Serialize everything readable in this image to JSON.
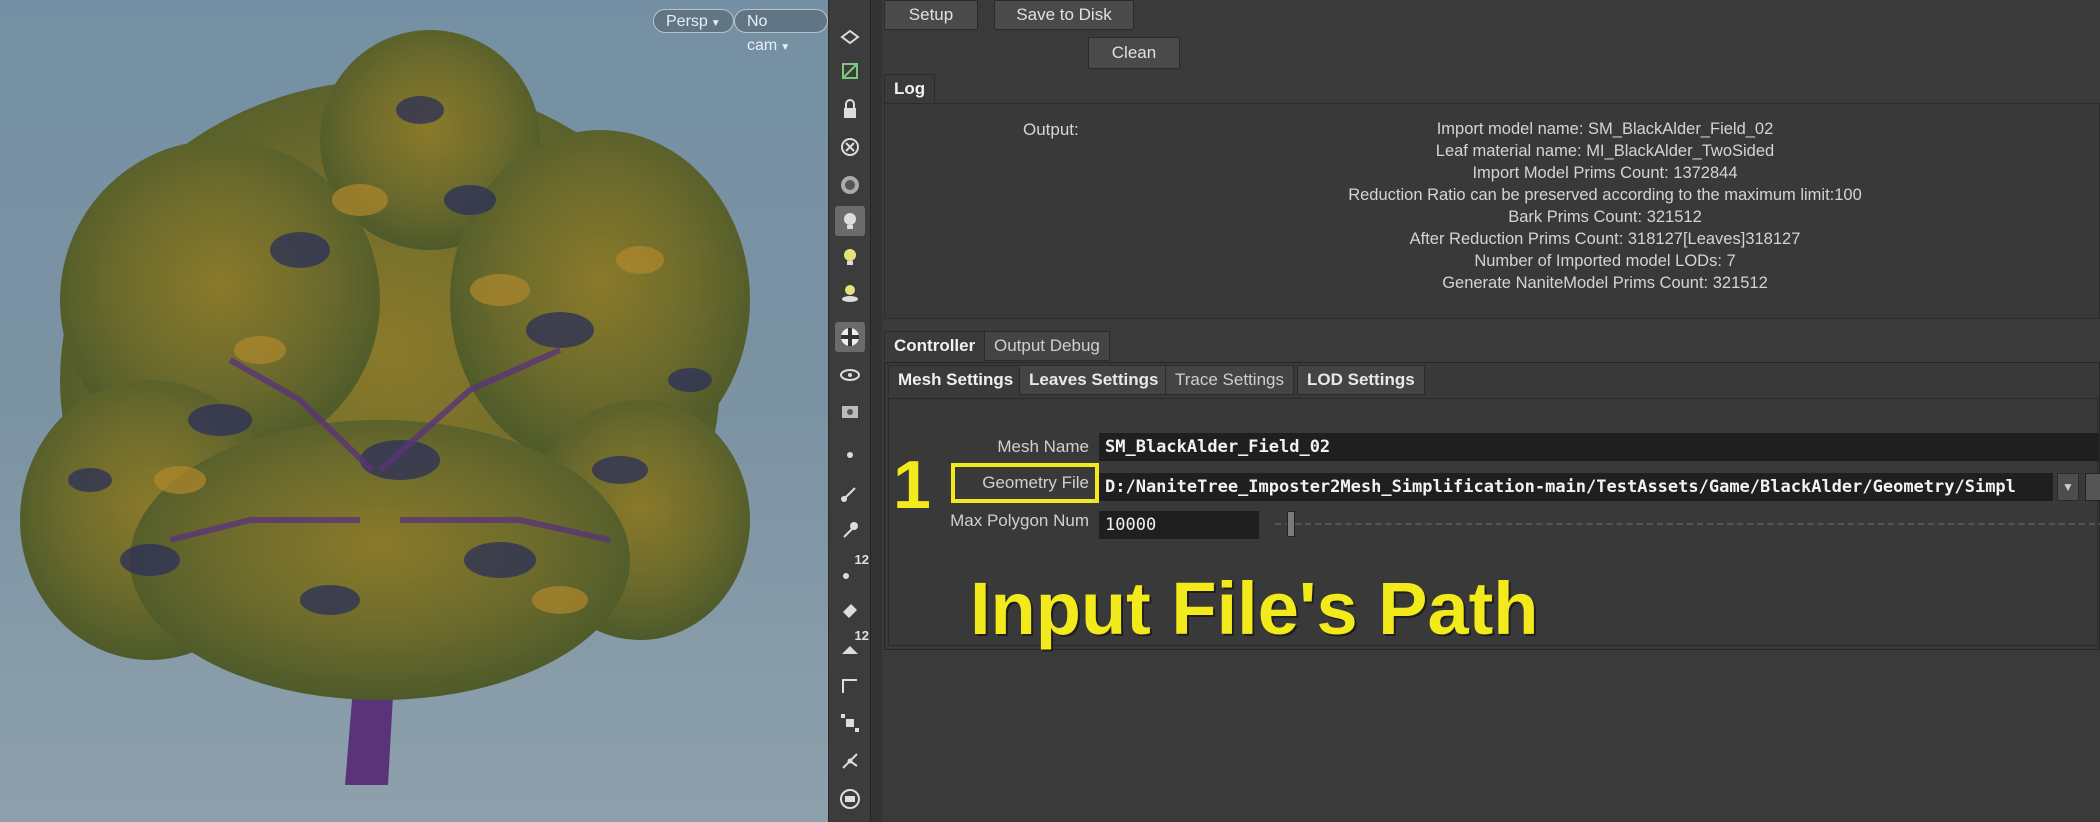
{
  "viewport": {
    "persp_label": "Persp",
    "cam_label": "No cam"
  },
  "toolbar": {
    "icons": [
      "select-object-icon",
      "display-geometry-icon",
      "lock-icon",
      "light-off-icon",
      "ambient-occlusion-icon",
      "light-bulb-icon",
      "light-add-icon",
      "headlight-icon",
      "checker-texture-icon",
      "view-eye-icon",
      "camera-eye-icon",
      "point-dot-icon",
      "brush-icon",
      "pin-icon",
      "point-number-icon",
      "paint-bucket-icon",
      "prim-number-icon",
      "edge-icon",
      "transform-handle-icon",
      "vertex-handle-icon",
      "screen-icon"
    ],
    "point_number_badge": "12",
    "prim_number_badge": "12"
  },
  "buttons": {
    "setup": "Setup",
    "save_to_disk": "Save to Disk",
    "clean": "Clean"
  },
  "log": {
    "tab_label": "Log",
    "output_label": "Output:",
    "lines": [
      "Import model name: SM_BlackAlder_Field_02",
      "Leaf material name: MI_BlackAlder_TwoSided",
      "Import Model Prims Count: 1372844",
      "Reduction Ratio can be preserved according to the maximum limit:100",
      "Bark Prims Count: 321512",
      "After Reduction Prims Count: 318127[Leaves]318127",
      "Number of Imported model LODs: 7",
      "Generate NaniteModel Prims Count: 321512"
    ]
  },
  "controller_tabs": [
    "Controller",
    "Output Debug"
  ],
  "settings_tabs": [
    "Mesh Settings",
    "Leaves Settings",
    "Trace Settings",
    "LOD Settings"
  ],
  "params": {
    "mesh_name_label": "Mesh Name",
    "mesh_name_value": "SM_BlackAlder_Field_02",
    "geometry_file_label": "Geometry File",
    "geometry_file_value": "D:/NaniteTree_Imposter2Mesh_Simplification-main/TestAssets/Game/BlackAlder/Geometry/Simpl",
    "max_polygon_label": "Max Polygon Num",
    "max_polygon_value": "10000"
  },
  "annotation": {
    "step_number": "1",
    "caption": "Input File's Path",
    "highlight_color": "#f2ea1a"
  }
}
